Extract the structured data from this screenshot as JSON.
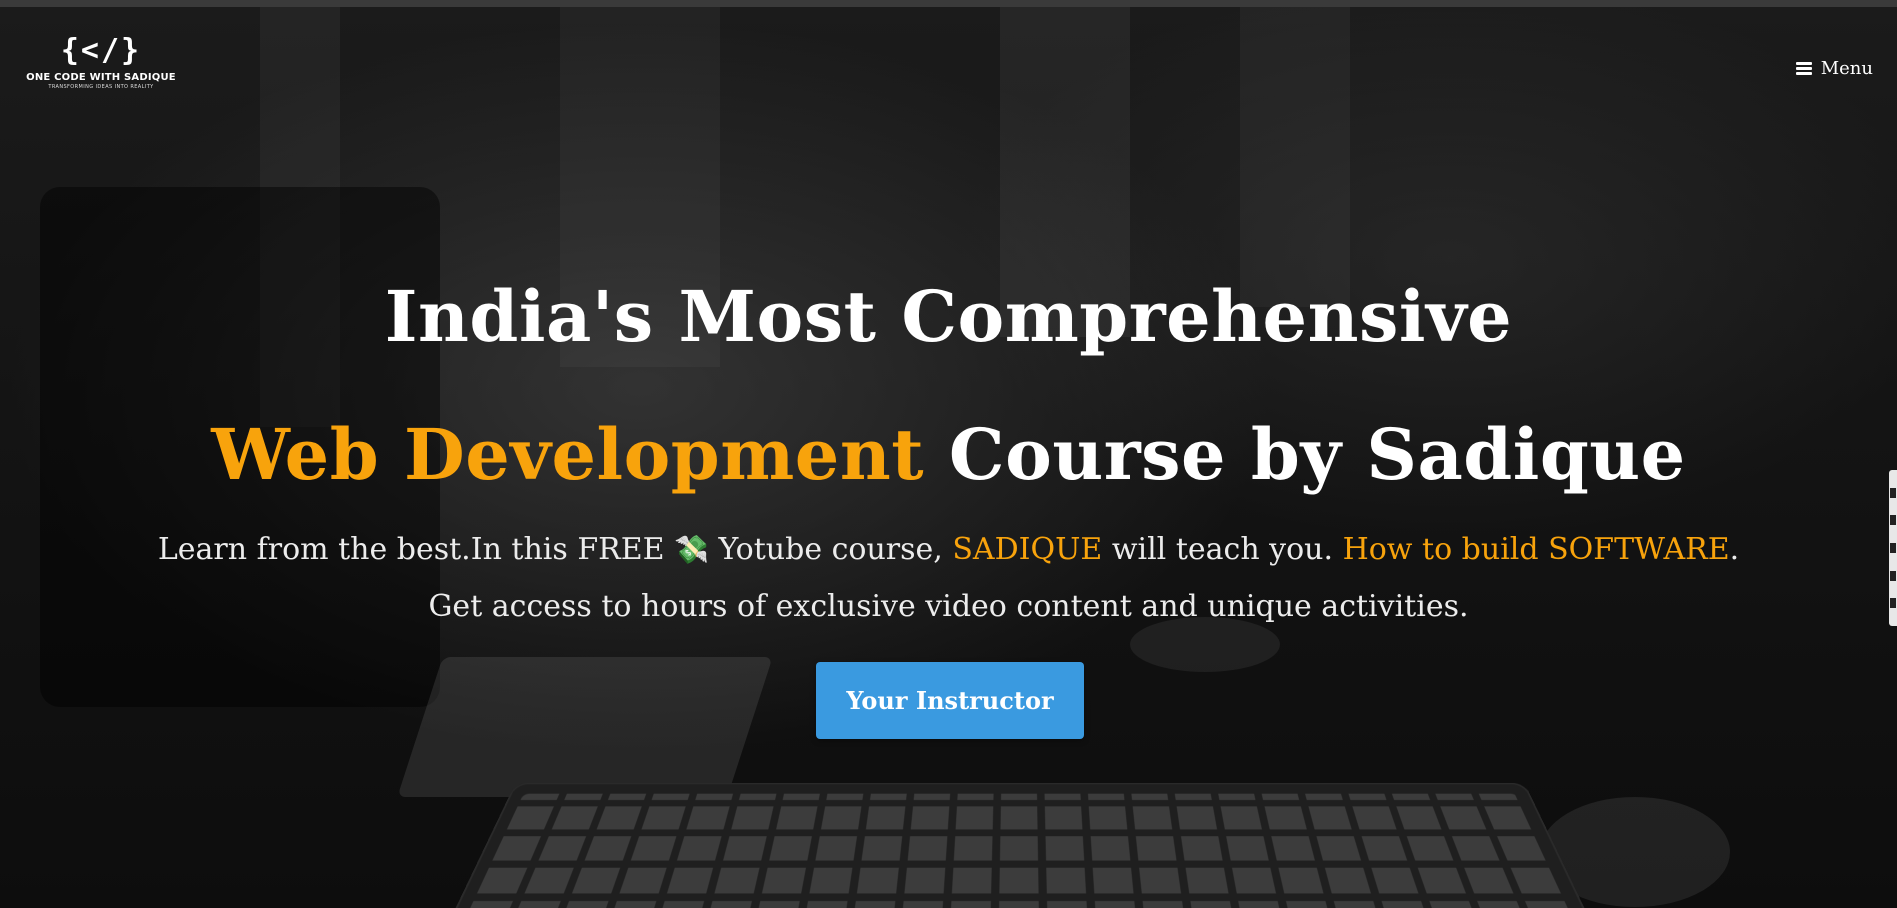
{
  "logo": {
    "mark": "{</}",
    "name": "ONE CODE WITH SADIQUE",
    "tagline": "TRANSFORMING IDEAS INTO REALITY"
  },
  "nav": {
    "menu_label": "Menu",
    "menu_icon": "hamburger-icon"
  },
  "hero": {
    "title_line1": "India's Most Comprehensive",
    "title_line2_accent": "Web Development",
    "title_line2_rest": " Course by Sadique",
    "description": {
      "part1": "Learn from the best.In this FREE ",
      "icon": "💸",
      "icon_name": "money-hand-icon",
      "part2": " Yotube course, ",
      "accent1": "SADIQUE",
      "part3": " will teach you. ",
      "accent2": "How to build SOFTWARE",
      "part4": "."
    },
    "description_line2": "Get access to hours of exclusive video content and unique activities.",
    "cta_label": "Your Instructor"
  },
  "colors": {
    "accent": "#f8a30c",
    "cta": "#3a9ae0",
    "text": "#ffffff"
  }
}
